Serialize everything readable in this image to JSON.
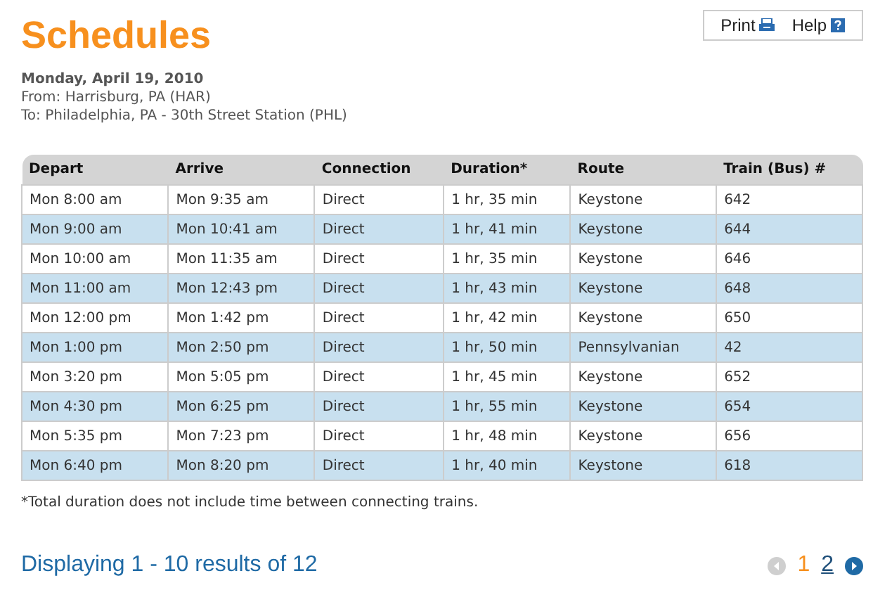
{
  "title": "Schedules",
  "toolbar": [
    {
      "label": "Print",
      "kind": "print"
    },
    {
      "label": "Help",
      "kind": "help"
    }
  ],
  "trip": {
    "date": "Monday, April 19, 2010",
    "from": "From: Harrisburg, PA (HAR)",
    "to": "To: Philadelphia, PA - 30th Street Station (PHL)"
  },
  "table": {
    "columns": [
      "Depart",
      "Arrive",
      "Connection",
      "Duration*",
      "Route",
      "Train (Bus) #"
    ],
    "rows": [
      [
        "Mon 8:00 am",
        "Mon 9:35 am",
        "Direct",
        "1 hr, 35 min",
        "Keystone",
        "642"
      ],
      [
        "Mon 9:00 am",
        "Mon 10:41 am",
        "Direct",
        "1 hr, 41 min",
        "Keystone",
        "644"
      ],
      [
        "Mon 10:00 am",
        "Mon 11:35 am",
        "Direct",
        "1 hr, 35 min",
        "Keystone",
        "646"
      ],
      [
        "Mon 11:00 am",
        "Mon 12:43 pm",
        "Direct",
        "1 hr, 43 min",
        "Keystone",
        "648"
      ],
      [
        "Mon 12:00 pm",
        "Mon 1:42 pm",
        "Direct",
        "1 hr, 42 min",
        "Keystone",
        "650"
      ],
      [
        "Mon 1:00 pm",
        "Mon 2:50 pm",
        "Direct",
        "1 hr, 50 min",
        "Pennsylvanian",
        "42"
      ],
      [
        "Mon 3:20 pm",
        "Mon 5:05 pm",
        "Direct",
        "1 hr, 45 min",
        "Keystone",
        "652"
      ],
      [
        "Mon 4:30 pm",
        "Mon 6:25 pm",
        "Direct",
        "1 hr, 55 min",
        "Keystone",
        "654"
      ],
      [
        "Mon 5:35 pm",
        "Mon 7:23 pm",
        "Direct",
        "1 hr, 48 min",
        "Keystone",
        "656"
      ],
      [
        "Mon 6:40 pm",
        "Mon 8:20 pm",
        "Direct",
        "1 hr, 40 min",
        "Keystone",
        "618"
      ]
    ]
  },
  "footnote": "*Total duration does not include time between connecting trains.",
  "results": "Displaying 1 - 10 results of 12",
  "pagination": {
    "prev_disabled": true,
    "next_disabled": false,
    "pages": [
      {
        "label": "1",
        "selected": true
      },
      {
        "label": "2",
        "selected": false
      }
    ]
  }
}
